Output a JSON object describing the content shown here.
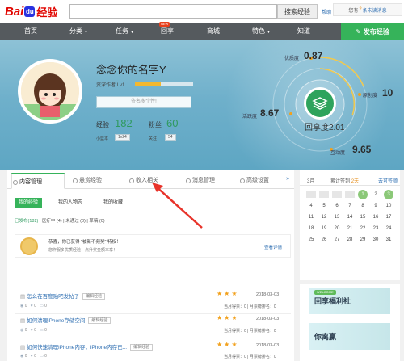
{
  "header": {
    "logo_bai": "Bai",
    "logo_du": "du",
    "logo_jingyan": "经验",
    "search_placeholder": "",
    "search_button": "搜索经验",
    "help_link": "帮助",
    "notice_prefix": "您有",
    "notice_count": "2",
    "notice_suffix": "条未读消息",
    "notice_more": ""
  },
  "nav": {
    "items": [
      {
        "label": "首页"
      },
      {
        "label": "分类"
      },
      {
        "label": "任务"
      },
      {
        "label": "回享"
      },
      {
        "label": "商城"
      },
      {
        "label": "特色"
      },
      {
        "label": "知道"
      }
    ],
    "new_badge": "NEW",
    "publish": "发布经验"
  },
  "profile": {
    "username": "念念你的名字Y",
    "level": "资深作者 Lv1",
    "level_progress": 0.45,
    "signature_placeholder": "签名多个性!",
    "experience_label": "经验",
    "experience_value": "182",
    "fans_label": "粉丝",
    "fans_value": "60",
    "guan_label": "小篮本",
    "guan_chip": "1v24",
    "follow_label": "关注",
    "follow_chip": "54"
  },
  "metrics": {
    "quality_label": "优质度",
    "quality_value": "0.87",
    "originality_label": "原创度",
    "originality_value": "10",
    "activity_label": "活跃度",
    "activity_value": "8.67",
    "interaction_label": "互动度",
    "interaction_value": "9.65",
    "main_label": "回享度",
    "main_value": "2.01"
  },
  "tabs": [
    {
      "label": "内容管理"
    },
    {
      "label": "悬赏经验"
    },
    {
      "label": "收入相关"
    },
    {
      "label": "消息管理"
    },
    {
      "label": "高级设置"
    }
  ],
  "tab_more": "»",
  "subtabs": [
    {
      "label": "我的经验"
    },
    {
      "label": "我的人物志"
    },
    {
      "label": "我的收藏"
    }
  ],
  "filters": {
    "published_label": "已发布",
    "published_count": "(182)",
    "reviewing": "| 医疗中 (4)",
    "rejected": "| 未通过 (0)",
    "drafts": "| 草稿 (0)"
  },
  "congrats": {
    "text": "恭喜，你已获得 \"被新不频奖\" 特权！",
    "sub": "您作服多优质经验！点升奖金额本享！",
    "link": "查看详情"
  },
  "rows": [
    {
      "title": "怎么在百度贴吧发帖子",
      "edit": "编辑经验",
      "stars": "★★★",
      "date": "2018-03-03",
      "views": "0",
      "comments": "0",
      "likes": "0",
      "right": "当月得票：0 | 月票榜排名：0"
    },
    {
      "title": "如何清理iPhone存储空间",
      "edit": "编辑经验",
      "stars": "★★★",
      "date": "2018-03-03",
      "views": "0",
      "comments": "0",
      "likes": "0",
      "right": "当月得票：0 | 月票榜排名：0"
    },
    {
      "title": "如何快速清理iPhone内存，iPhone内存已...",
      "edit": "编辑经验",
      "stars": "★★★",
      "date": "2018-03-03",
      "views": "0",
      "comments": "0",
      "likes": "0",
      "right": "当月得票：0 | 月票榜排名：0"
    }
  ],
  "calendar": {
    "month": "3月",
    "sign_prefix": "累计签到",
    "sign_days": "2天",
    "sign_link": "去可签顺",
    "days": [
      "1",
      "2",
      "3",
      "4",
      "5",
      "6",
      "7",
      "8",
      "9",
      "10",
      "11",
      "12",
      "13",
      "14",
      "15",
      "16",
      "17",
      "18",
      "19",
      "20",
      "21",
      "22",
      "23",
      "24",
      "25",
      "26",
      "27",
      "28",
      "29",
      "30",
      "31"
    ],
    "highlighted": [
      "1",
      "3"
    ]
  },
  "ads": [
    {
      "tag": "WELCOME",
      "text": "回享福利社"
    },
    {
      "tag": "",
      "text": "你离赢"
    }
  ],
  "colors": {
    "brand_green": "#36b35a",
    "nav_bg": "#555a5e",
    "link_blue": "#2f6fb2",
    "star": "#f2a11d"
  }
}
